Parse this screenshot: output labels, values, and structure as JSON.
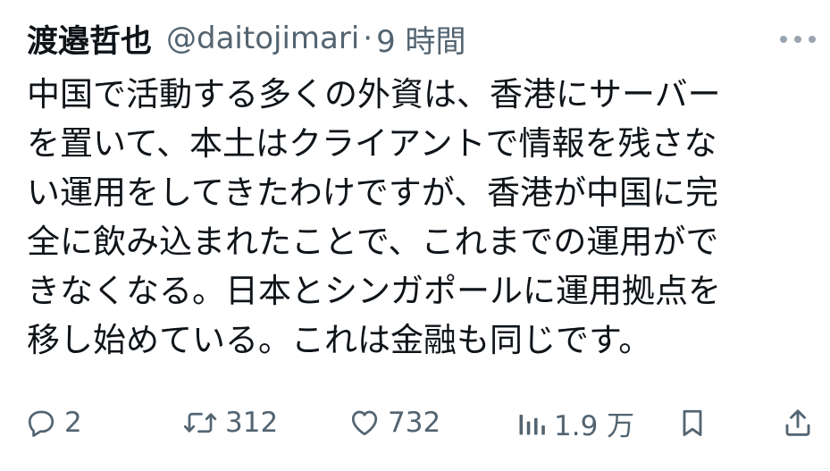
{
  "tweet": {
    "display_name": "渡邉哲也",
    "handle": "@daitojimari",
    "separator": "·",
    "time": "9 時間",
    "text": "中国で活動する多くの外資は、香港にサーバー\nを置いて、本土はクライアントで情報を残さな\nい運用をしてきたわけですが、香港が中国に完\n全に飲み込まれたことで、これまでの運用がで\nきなくなる。日本とシンガポールに運用拠点を\n移し始めている。これは金融も同じです。"
  },
  "actions": {
    "reply_count": "2",
    "retweet_count": "312",
    "like_count": "732",
    "views_count": "1.9 万"
  },
  "icons": {
    "more": "more-horizontal-icon",
    "reply": "reply-icon",
    "retweet": "retweet-icon",
    "like": "heart-icon",
    "views": "analytics-icon",
    "bookmark": "bookmark-icon",
    "share": "share-icon"
  },
  "colors": {
    "text": "#0f1419",
    "muted": "#536471"
  }
}
